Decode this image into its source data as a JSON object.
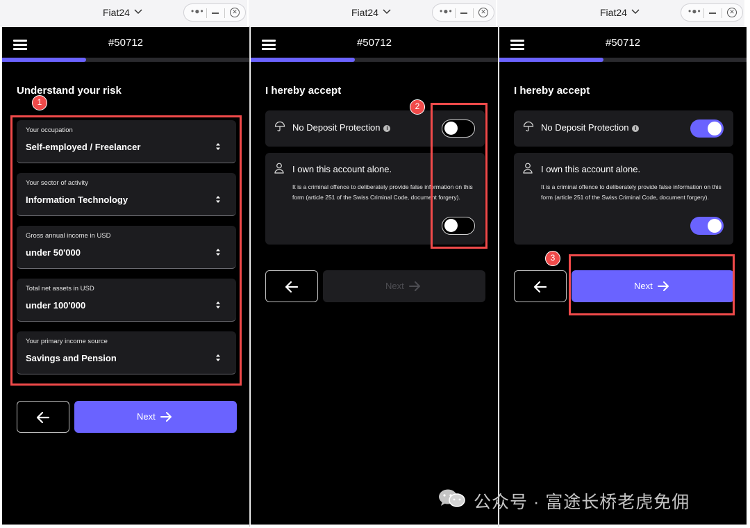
{
  "window": {
    "app_title": "Fiat24",
    "capsule": {
      "more": "•●•",
      "minimize": "—",
      "close": "✕"
    }
  },
  "header": {
    "account_id": "#50712"
  },
  "panel1": {
    "progress": 0.34,
    "heading": "Understand your risk",
    "fields": [
      {
        "label": "Your occupation",
        "value": "Self-employed / Freelancer"
      },
      {
        "label": "Your sector of activity",
        "value": "Information Technology"
      },
      {
        "label": "Gross annual income in USD",
        "value": "under 50'000"
      },
      {
        "label": "Total net assets in USD",
        "value": "under 100'000"
      },
      {
        "label": "Your primary income source",
        "value": "Savings and Pension"
      }
    ],
    "next_label": "Next",
    "badge": "1"
  },
  "panel2": {
    "progress": 0.42,
    "heading": "I hereby accept",
    "deposit_title": "No Deposit Protection",
    "deposit_toggle_on": false,
    "own_title": "I own this account alone.",
    "own_desc": "It is a criminal offence to deliberately provide false information on this form (article 251 of the Swiss Criminal Code, document forgery).",
    "own_toggle_on": false,
    "next_label": "Next",
    "next_enabled": false,
    "badge": "2"
  },
  "panel3": {
    "progress": 0.42,
    "heading": "I hereby accept",
    "deposit_title": "No Deposit Protection",
    "deposit_toggle_on": true,
    "own_title": "I own this account alone.",
    "own_desc": "It is a criminal offence to deliberately provide false information on this form (article 251 of the Swiss Criminal Code, document forgery).",
    "own_toggle_on": true,
    "next_label": "Next",
    "next_enabled": true,
    "badge": "3"
  },
  "watermark": {
    "text": "公众号 · 富途长桥老虎免佣"
  },
  "colors": {
    "accent": "#6a63ff",
    "highlight": "#f04a4a",
    "card": "#1c1c1f",
    "background": "#000000"
  },
  "icons": [
    "menu-icon",
    "chevron-down-icon",
    "more-icon",
    "minimize-icon",
    "close-icon",
    "select-arrows-icon",
    "back-arrow-icon",
    "next-arrow-icon",
    "umbrella-icon",
    "info-icon",
    "person-icon",
    "wechat-icon"
  ]
}
